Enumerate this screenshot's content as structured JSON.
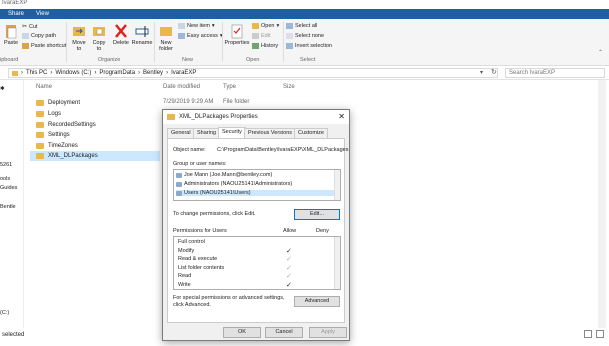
{
  "window": {
    "title": "IvaraEXP"
  },
  "ribbon": {
    "tabs": [
      "Share",
      "View"
    ],
    "clipboard": {
      "paste": "Paste",
      "cut": "Cut",
      "copy_path": "Copy path",
      "paste_shortcut": "Paste shortcut",
      "group": "ipboard"
    },
    "organize": {
      "move_to": "Move\nto",
      "copy_to": "Copy\nto",
      "delete": "Delete",
      "rename": "Rename",
      "group": "Organize"
    },
    "new": {
      "new_folder": "New\nfolder",
      "new_item": "New item",
      "easy_access": "Easy access",
      "group": "New"
    },
    "open": {
      "properties": "Properties",
      "open": "Open",
      "edit": "Edit",
      "history": "History",
      "group": "Open"
    },
    "select": {
      "select_all": "Select all",
      "select_none": "Select none",
      "invert": "Invert selection",
      "group": "Select"
    }
  },
  "address": {
    "crumbs": [
      "This PC",
      "Windows (C:)",
      "ProgramData",
      "Bentley",
      "IvaraEXP"
    ],
    "search_placeholder": "Search IvaraEXP"
  },
  "nav": {
    "items": [
      "5261",
      "ools",
      "Guides",
      "Bentle",
      "(C:)"
    ]
  },
  "list": {
    "headers": {
      "name": "Name",
      "date": "Date modified",
      "type": "Type",
      "size": "Size"
    },
    "rows": [
      "Deployment",
      "Logs",
      "RecordedSettings",
      "Settings",
      "TimeZones",
      "XML_DLPackages"
    ],
    "first_date": "7/29/2019 9:29 AM",
    "first_type": "File folder"
  },
  "status": {
    "text": "selected"
  },
  "dialog": {
    "title": "XML_DLPackages Properties",
    "tabs": [
      "General",
      "Sharing",
      "Security",
      "Previous Versions",
      "Customize"
    ],
    "object_name_label": "Object name:",
    "object_name_value": "C:\\ProgramData\\Bentley\\IvaraEXP\\XML_DLPackages",
    "group_label": "Group or user names:",
    "users": [
      "Joe Mann (Joe.Mann@bentley.com)",
      "Administrators (NAOU25141\\Administrators)",
      "Users (NAOU25141\\Users)"
    ],
    "change_text": "To change permissions, click Edit.",
    "edit_btn": "Edit...",
    "perm_header": "Permissions for Users",
    "allow": "Allow",
    "deny": "Deny",
    "permissions": [
      "Full control",
      "Modify",
      "Read & execute",
      "List folder contents",
      "Read",
      "Write"
    ],
    "special_text": "For special permissions or advanced settings, click Advanced.",
    "advanced_btn": "Advanced",
    "ok": "OK",
    "cancel": "Cancel",
    "apply": "Apply"
  }
}
